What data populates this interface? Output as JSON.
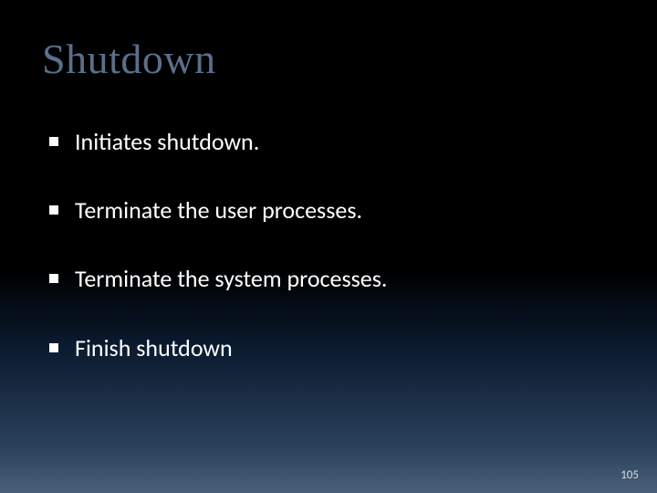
{
  "title": "Shutdown",
  "bullets": [
    "Initiates shutdown.",
    "Terminate the user processes.",
    "Terminate the system processes.",
    "Finish shutdown"
  ],
  "page_number": "105"
}
